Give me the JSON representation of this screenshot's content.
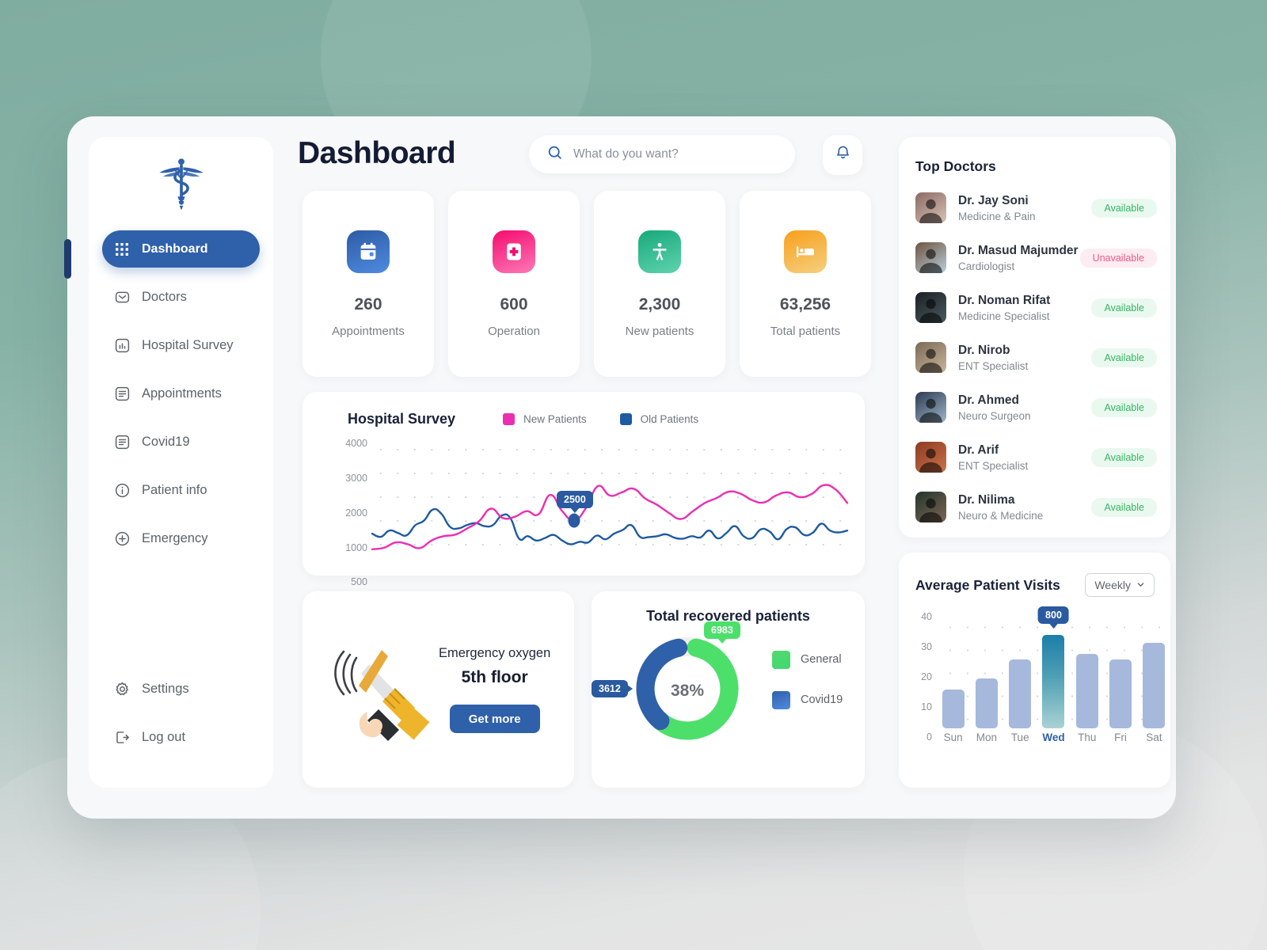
{
  "theme": {
    "bg_green": "#86b0a4",
    "accent_blue": "#2f60aa",
    "pink": "#ec2eb2",
    "green": "#4ce06a",
    "available_color": "#35b563",
    "unavailable_color": "#ef5a86"
  },
  "sidebar": {
    "logo_name": "caduceus-logo",
    "items": [
      {
        "label": "Dashboard",
        "icon": "grid-icon",
        "active": true
      },
      {
        "label": "Doctors",
        "icon": "envelope-icon",
        "active": false
      },
      {
        "label": "Hospital Survey",
        "icon": "bar-chart-icon",
        "active": false
      },
      {
        "label": "Appointments",
        "icon": "document-icon",
        "active": false
      },
      {
        "label": "Covid19",
        "icon": "document-icon",
        "active": false
      },
      {
        "label": "Patient info",
        "icon": "info-icon",
        "active": false
      },
      {
        "label": "Emergency",
        "icon": "plus-circle-icon",
        "active": false
      }
    ],
    "bottom_items": [
      {
        "label": "Settings",
        "icon": "gear-icon"
      },
      {
        "label": "Log out",
        "icon": "logout-icon"
      }
    ]
  },
  "header": {
    "title": "Dashboard",
    "search_placeholder": "What do you want?",
    "search_value": "",
    "search_icon": "search-icon",
    "bell_icon": "bell-icon"
  },
  "stats": [
    {
      "value": "260",
      "label": "Appointments",
      "icon": "calendar-icon",
      "c1": "#2d5ba4",
      "c2": "#4f8be0"
    },
    {
      "value": "600",
      "label": "Operation",
      "icon": "first-aid-icon",
      "c1": "#f50b6e",
      "c2": "#fd79b6"
    },
    {
      "value": "2,300",
      "label": "New patients",
      "icon": "accessibility-icon",
      "c1": "#17a97a",
      "c2": "#5fd3ae"
    },
    {
      "value": "63,256",
      "label": "Total patients",
      "icon": "hospital-bed-icon",
      "c1": "#f7a01c",
      "c2": "#f6cf7f"
    }
  ],
  "chart_data": [
    {
      "type": "line",
      "title": "Hospital Survey",
      "ylabel": "",
      "xlabel": "",
      "yticks": [
        4000,
        3000,
        2000,
        1000,
        500
      ],
      "ylim": [
        400,
        4200
      ],
      "grid": "dotted",
      "legend_position": "top-right",
      "annotation": {
        "label": "2500",
        "series": "New Patients",
        "point_index": 17
      },
      "series": [
        {
          "name": "New Patients",
          "color": "#ec2eb2",
          "values": [
            480,
            530,
            700,
            640,
            520,
            760,
            900,
            950,
            1150,
            1380,
            1780,
            1480,
            1520,
            1700,
            1600,
            2220,
            1700,
            1400,
            1800,
            2500,
            2200,
            2300,
            2420,
            2100,
            1900,
            1640,
            1450,
            1700,
            1960,
            2120,
            2320,
            2260,
            2050,
            1980,
            2200,
            2300,
            2150,
            2250,
            2530,
            2400,
            1960
          ]
        },
        {
          "name": "Old Patients",
          "color": "#1e5ba0",
          "values": [
            980,
            880,
            1080,
            1000,
            930,
            1250,
            1400,
            1750,
            1620,
            1200,
            1150,
            1260,
            1320,
            1220,
            1260,
            1560,
            1480,
            820,
            900,
            760,
            840,
            940,
            760,
            640,
            720,
            700,
            920,
            800,
            980,
            1100,
            1250,
            880,
            870,
            900,
            960,
            850,
            820,
            900,
            860,
            1080,
            830,
            1000,
            1220,
            900,
            840,
            1120,
            1050,
            800,
            1130,
            1180,
            940,
            1010,
            1300,
            1080,
            1020,
            1080
          ]
        }
      ]
    },
    {
      "type": "pie",
      "title": "Total recovered patients",
      "center_label": "38%",
      "labels": [
        "General",
        "Covid19"
      ],
      "values": [
        6983,
        3612
      ],
      "colors": [
        "#4ce06a",
        "#2f60aa"
      ],
      "annotations": [
        {
          "label": "6983",
          "slice": "General",
          "color": "#4ce06a"
        },
        {
          "label": "3612",
          "slice": "Covid19",
          "color": "#2a5aa0"
        }
      ],
      "legend_position": "right"
    },
    {
      "type": "bar",
      "title": "Average Patient Visits",
      "categories": [
        "Sun",
        "Mon",
        "Tue",
        "Wed",
        "Thu",
        "Fri",
        "Sat"
      ],
      "values": [
        14,
        18,
        25,
        34,
        27,
        25,
        31
      ],
      "yticks": [
        40,
        30,
        20,
        10,
        0
      ],
      "ylim": [
        0,
        42
      ],
      "highlight_index": 3,
      "annotation": {
        "label": "800",
        "category": "Wed"
      },
      "grid": "dotted",
      "bar_color": "#a6b9dc",
      "highlight_color": "#1c7ea8"
    }
  ],
  "oxygen": {
    "icon": "megaphone-icon",
    "subtitle": "Emergency oxygen",
    "title": "5th floor",
    "button_label": "Get more"
  },
  "recovered": {
    "title": "Total recovered patients"
  },
  "doctors_panel": {
    "title": "Top Doctors",
    "rows": [
      {
        "name": "Dr. Jay Soni",
        "specialty": "Medicine & Pain",
        "status": "Available",
        "available": true,
        "av1": "#8a6a63",
        "av2": "#d8c3b6"
      },
      {
        "name": "Dr. Masud Majumder",
        "specialty": "Cardiologist",
        "status": "Unavailable",
        "available": false,
        "av1": "#6f5440",
        "av2": "#b8cfdc"
      },
      {
        "name": "Dr. Noman Rifat",
        "specialty": "Medicine Specialist",
        "status": "Available",
        "available": true,
        "av1": "#1b2024",
        "av2": "#4a5a60"
      },
      {
        "name": "Dr. Nirob",
        "specialty": "ENT Specialist",
        "status": "Available",
        "available": true,
        "av1": "#7b6a55",
        "av2": "#c8b59a"
      },
      {
        "name": "Dr. Ahmed",
        "specialty": "Neuro Surgeon",
        "status": "Available",
        "available": true,
        "av1": "#2c3b52",
        "av2": "#9fb6c9"
      },
      {
        "name": "Dr. Arif",
        "specialty": "ENT Specialist",
        "status": "Available",
        "available": true,
        "av1": "#8d3a22",
        "av2": "#c9744a"
      },
      {
        "name": "Dr. Nilima",
        "specialty": "Neuro & Medicine",
        "status": "Available",
        "available": true,
        "av1": "#23352c",
        "av2": "#7e6656"
      }
    ]
  },
  "visits_panel": {
    "title": "Average Patient Visits",
    "range_label": "Weekly",
    "chevron_icon": "chevron-down-icon"
  },
  "survey_legend": [
    {
      "label": "New Patients",
      "color": "#ec2eb2"
    },
    {
      "label": "Old Patients",
      "color": "#1e5ba0"
    }
  ]
}
